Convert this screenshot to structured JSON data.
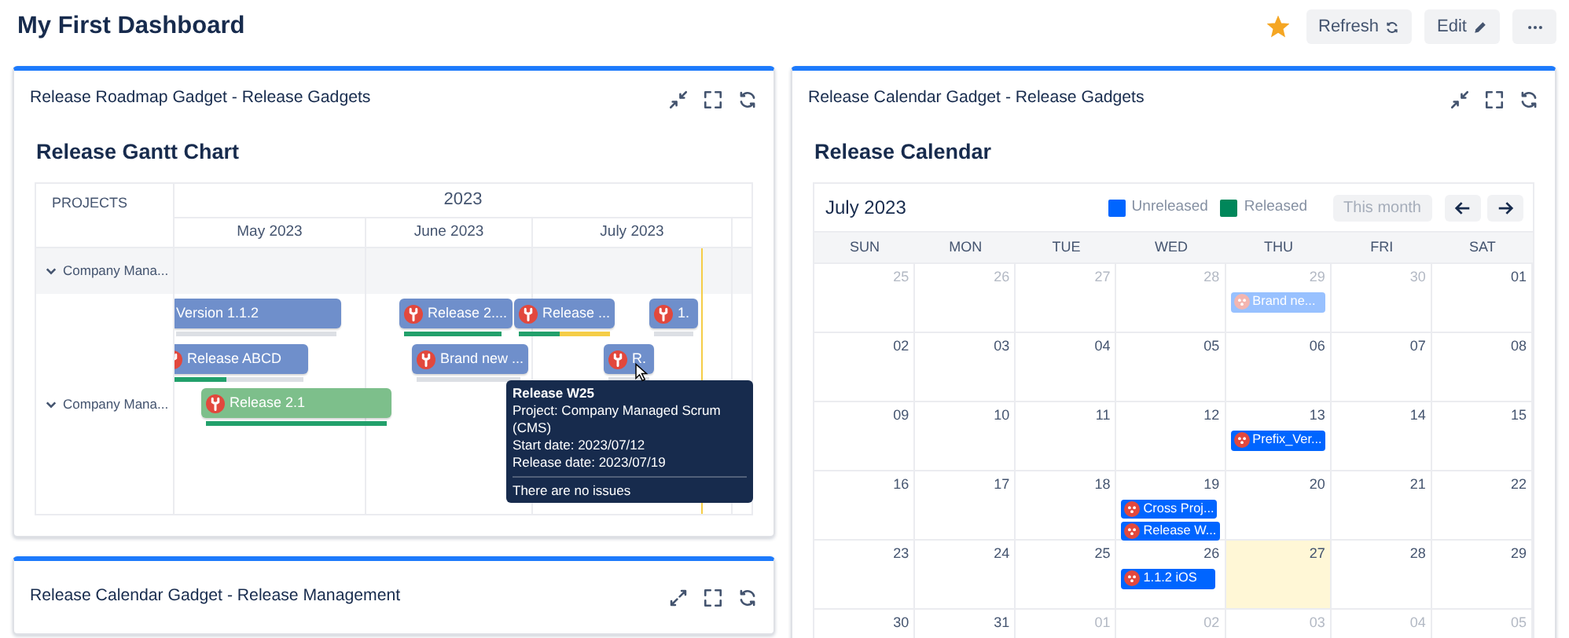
{
  "page": {
    "title": "My First Dashboard",
    "starred": true,
    "actions": [
      {
        "kind": "refresh",
        "label": "Refresh"
      },
      {
        "kind": "edit",
        "label": "Edit"
      },
      {
        "kind": "more"
      }
    ]
  },
  "columns": [
    {
      "gadgets": [
        {
          "kind": "gantt",
          "title": "Release Roadmap Gadget - Release Gadgets",
          "expanded": true,
          "heading": "Release Gantt Chart",
          "gantt": {
            "projects_header": "PROJECTS",
            "year": "2023",
            "months": [
              "May 2023",
              "June 2023",
              "July 2023"
            ],
            "groups": [
              {
                "label": "Company Mana...",
                "expanded": true
              },
              {
                "label": "Company Mana...",
                "expanded": true
              }
            ],
            "bars": [
              {
                "label": "Version 1.1.2",
                "kind": "unreleased"
              },
              {
                "label": "Release 2....",
                "kind": "unreleased",
                "progress": [
                  {
                    "kind": "done",
                    "level": 1
                  }
                ]
              },
              {
                "label": "Release ...",
                "kind": "unreleased",
                "progress": [
                  {
                    "kind": "done",
                    "level": 0.45
                  },
                  {
                    "kind": "in_progress",
                    "level": 0.55
                  }
                ]
              },
              {
                "label": "1.",
                "kind": "unreleased"
              },
              {
                "label": "Release ABCD",
                "kind": "unreleased",
                "progress": [
                  {
                    "kind": "done",
                    "level": 0.45
                  }
                ]
              },
              {
                "label": "Brand new ...",
                "kind": "unreleased"
              },
              {
                "label": "R.",
                "kind": "unreleased"
              },
              {
                "label": "Release 2.1",
                "kind": "released",
                "progress": [
                  {
                    "kind": "done",
                    "level": 1
                  }
                ]
              }
            ],
            "tooltip": {
              "title": "Release W25",
              "lines": [
                "Project: Company Managed Scrum (CMS)",
                "Start date: 2023/07/12",
                "Release date: 2023/07/19"
              ],
              "footer": "There are no issues"
            }
          }
        },
        {
          "kind": "empty",
          "title": "Release Calendar Gadget - Release Management",
          "expanded": false
        }
      ]
    },
    {
      "gadgets": [
        {
          "kind": "calendar",
          "title": "Release Calendar Gadget - Release Gadgets",
          "expanded": true,
          "heading": "Release Calendar",
          "calendar": {
            "month": "July 2023",
            "legend": [
              {
                "label": "Unreleased",
                "color": "#0065ff"
              },
              {
                "label": "Released",
                "color": "#00875a"
              }
            ],
            "today_button": "This month",
            "weekdays": [
              "SUN",
              "MON",
              "TUE",
              "WED",
              "THU",
              "FRI",
              "SAT"
            ],
            "weeks": [
              [
                {
                  "day": "25",
                  "outside": true,
                  "today": false
                },
                {
                  "day": "26",
                  "outside": true,
                  "today": false
                },
                {
                  "day": "27",
                  "outside": true,
                  "today": false
                },
                {
                  "day": "28",
                  "outside": true,
                  "today": false
                },
                {
                  "day": "29",
                  "outside": true,
                  "today": false,
                  "events": [
                    {
                      "label": "Brand ne...",
                      "kind": "unreleased"
                    }
                  ]
                },
                {
                  "day": "30",
                  "outside": true,
                  "today": false
                },
                {
                  "day": "01",
                  "outside": false,
                  "today": false
                }
              ],
              [
                {
                  "day": "02",
                  "outside": false,
                  "today": false
                },
                {
                  "day": "03",
                  "outside": false,
                  "today": false
                },
                {
                  "day": "04",
                  "outside": false,
                  "today": false
                },
                {
                  "day": "05",
                  "outside": false,
                  "today": false
                },
                {
                  "day": "06",
                  "outside": false,
                  "today": false
                },
                {
                  "day": "07",
                  "outside": false,
                  "today": false
                },
                {
                  "day": "08",
                  "outside": false,
                  "today": false
                }
              ],
              [
                {
                  "day": "09",
                  "outside": false,
                  "today": false
                },
                {
                  "day": "10",
                  "outside": false,
                  "today": false
                },
                {
                  "day": "11",
                  "outside": false,
                  "today": false
                },
                {
                  "day": "12",
                  "outside": false,
                  "today": false
                },
                {
                  "day": "13",
                  "outside": false,
                  "today": false,
                  "events": [
                    {
                      "label": "Prefix_Ver...",
                      "kind": "unreleased"
                    }
                  ]
                },
                {
                  "day": "14",
                  "outside": false,
                  "today": false
                },
                {
                  "day": "15",
                  "outside": false,
                  "today": false
                }
              ],
              [
                {
                  "day": "16",
                  "outside": false,
                  "today": false
                },
                {
                  "day": "17",
                  "outside": false,
                  "today": false
                },
                {
                  "day": "18",
                  "outside": false,
                  "today": false
                },
                {
                  "day": "19",
                  "outside": false,
                  "today": false,
                  "events": [
                    {
                      "label": "Cross Proj...",
                      "kind": "unreleased"
                    },
                    {
                      "label": "Release W...",
                      "kind": "unreleased"
                    }
                  ]
                },
                {
                  "day": "20",
                  "outside": false,
                  "today": false
                },
                {
                  "day": "21",
                  "outside": false,
                  "today": false
                },
                {
                  "day": "22",
                  "outside": false,
                  "today": false
                }
              ],
              [
                {
                  "day": "23",
                  "outside": false,
                  "today": false
                },
                {
                  "day": "24",
                  "outside": false,
                  "today": false
                },
                {
                  "day": "25",
                  "outside": false,
                  "today": false
                },
                {
                  "day": "26",
                  "outside": false,
                  "today": false,
                  "events": [
                    {
                      "label": "1.1.2 iOS",
                      "kind": "unreleased"
                    }
                  ]
                },
                {
                  "day": "27",
                  "outside": false,
                  "today": true
                },
                {
                  "day": "28",
                  "outside": false,
                  "today": false
                },
                {
                  "day": "29",
                  "outside": false,
                  "today": false
                }
              ],
              [
                {
                  "day": "30",
                  "outside": false,
                  "today": false
                },
                {
                  "day": "31",
                  "outside": false,
                  "today": false
                },
                {
                  "day": "01",
                  "outside": true,
                  "today": false
                },
                {
                  "day": "02",
                  "outside": true,
                  "today": false
                },
                {
                  "day": "03",
                  "outside": true,
                  "today": false
                },
                {
                  "day": "04",
                  "outside": true,
                  "today": false
                },
                {
                  "day": "05",
                  "outside": true,
                  "today": false
                }
              ]
            ]
          }
        }
      ]
    }
  ]
}
